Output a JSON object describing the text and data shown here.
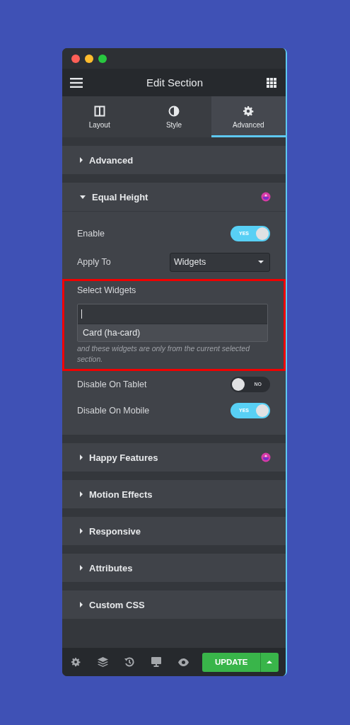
{
  "header": {
    "title": "Edit Section"
  },
  "tabs": [
    {
      "label": "Layout",
      "selected": false
    },
    {
      "label": "Style",
      "selected": false
    },
    {
      "label": "Advanced",
      "selected": true
    }
  ],
  "sections": [
    {
      "title": "Advanced",
      "expanded": false,
      "badge": false
    },
    {
      "title": "Equal Height",
      "expanded": true,
      "badge": true,
      "controls": [
        {
          "kind": "toggle",
          "label": "Enable",
          "on": true,
          "text": "YES"
        },
        {
          "kind": "select",
          "label": "Apply To",
          "value": "Widgets"
        },
        {
          "kind": "multiselect",
          "label": "Select Widgets",
          "highlighted": true,
          "options": [
            "Card (ha-card)"
          ],
          "note": "and these widgets are only from the current selected section."
        },
        {
          "kind": "toggle",
          "label": "Disable On Tablet",
          "on": false,
          "text": "NO"
        },
        {
          "kind": "toggle",
          "label": "Disable On Mobile",
          "on": true,
          "text": "YES"
        }
      ]
    },
    {
      "title": "Happy Features",
      "expanded": false,
      "badge": true
    },
    {
      "title": "Motion Effects",
      "expanded": false,
      "badge": false
    },
    {
      "title": "Responsive",
      "expanded": false,
      "badge": false
    },
    {
      "title": "Attributes",
      "expanded": false,
      "badge": false
    },
    {
      "title": "Custom CSS",
      "expanded": false,
      "badge": false
    }
  ],
  "footer": {
    "button": "UPDATE"
  }
}
